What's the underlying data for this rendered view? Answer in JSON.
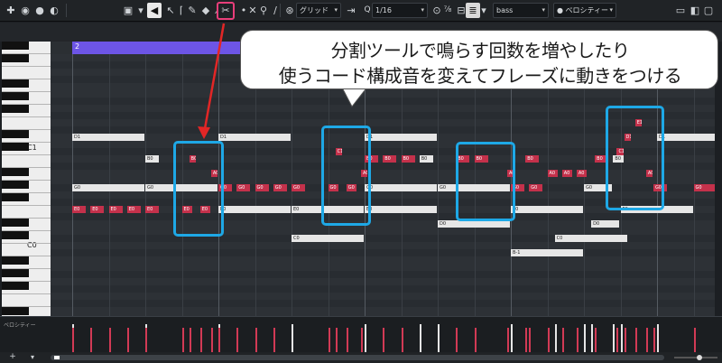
{
  "toolbar": {
    "snap_mode": "グリッド",
    "quantize": "1/16",
    "track": "bass",
    "lane": "ベロシティー"
  },
  "keyboard": {
    "c1_label": "C1",
    "c0_label": "C0"
  },
  "ruler": {
    "bar_number": "2"
  },
  "notes": [
    {
      "pitch": "D1",
      "start": 0,
      "len": 10,
      "row": 11,
      "color": "w"
    },
    {
      "pitch": "D1",
      "start": 20,
      "len": 10,
      "row": 11,
      "color": "w"
    },
    {
      "pitch": "B0",
      "start": 10,
      "len": 2,
      "row": 14,
      "color": "w"
    },
    {
      "pitch": "B0",
      "start": 16,
      "len": 1,
      "row": 14,
      "color": "r"
    },
    {
      "pitch": "A0",
      "start": 19,
      "len": 1,
      "row": 16,
      "color": "r"
    },
    {
      "pitch": "G0",
      "start": 0,
      "len": 10,
      "row": 18,
      "color": "w"
    },
    {
      "pitch": "G0",
      "start": 10,
      "len": 10,
      "row": 18,
      "color": "w"
    },
    {
      "pitch": "E0",
      "start": 0,
      "len": 2,
      "row": 21,
      "color": "r"
    },
    {
      "pitch": "E0",
      "start": 2.5,
      "len": 2,
      "row": 21,
      "color": "r"
    },
    {
      "pitch": "E0",
      "start": 5,
      "len": 2,
      "row": 21,
      "color": "r"
    },
    {
      "pitch": "E0",
      "start": 7.5,
      "len": 2,
      "row": 21,
      "color": "r"
    },
    {
      "pitch": "E0",
      "start": 10,
      "len": 2,
      "row": 21,
      "color": "r"
    },
    {
      "pitch": "E0",
      "start": 15,
      "len": 1.5,
      "row": 21,
      "color": "r"
    },
    {
      "pitch": "E0",
      "start": 17.5,
      "len": 1.5,
      "row": 21,
      "color": "r"
    },
    {
      "pitch": "E0",
      "start": 20,
      "len": 10,
      "row": 21,
      "color": "w"
    },
    {
      "pitch": "G0",
      "start": 20,
      "len": 2,
      "row": 18,
      "color": "r"
    },
    {
      "pitch": "G0",
      "start": 22.5,
      "len": 2,
      "row": 18,
      "color": "r"
    },
    {
      "pitch": "G0",
      "start": 25,
      "len": 2,
      "row": 18,
      "color": "r"
    },
    {
      "pitch": "G0",
      "start": 27.5,
      "len": 2,
      "row": 18,
      "color": "r"
    },
    {
      "pitch": "G0",
      "start": 30,
      "len": 2,
      "row": 18,
      "color": "r"
    },
    {
      "pitch": "G0",
      "start": 35,
      "len": 1.5,
      "row": 18,
      "color": "r"
    },
    {
      "pitch": "E0",
      "start": 30,
      "len": 10,
      "row": 21,
      "color": "w"
    },
    {
      "pitch": "C0",
      "start": 30,
      "len": 10,
      "row": 25,
      "color": "w"
    },
    {
      "pitch": "C1",
      "start": 36,
      "len": 1,
      "row": 13,
      "color": "r"
    },
    {
      "pitch": "A0",
      "start": 39.5,
      "len": 1,
      "row": 16,
      "color": "r"
    },
    {
      "pitch": "G0",
      "start": 37.5,
      "len": 1.5,
      "row": 18,
      "color": "r"
    },
    {
      "pitch": "D1",
      "start": 40,
      "len": 10,
      "row": 11,
      "color": "w"
    },
    {
      "pitch": "B0",
      "start": 40,
      "len": 2,
      "row": 14,
      "color": "r"
    },
    {
      "pitch": "B0",
      "start": 42.5,
      "len": 2,
      "row": 14,
      "color": "r"
    },
    {
      "pitch": "B0",
      "start": 45,
      "len": 2,
      "row": 14,
      "color": "r"
    },
    {
      "pitch": "B0",
      "start": 47.5,
      "len": 2,
      "row": 14,
      "color": "w"
    },
    {
      "pitch": "B0",
      "start": 52.5,
      "len": 2,
      "row": 14,
      "color": "r"
    },
    {
      "pitch": "B0",
      "start": 55,
      "len": 2,
      "row": 14,
      "color": "r"
    },
    {
      "pitch": "G0",
      "start": 40,
      "len": 10,
      "row": 18,
      "color": "w"
    },
    {
      "pitch": "E0",
      "start": 40,
      "len": 10,
      "row": 21,
      "color": "w"
    },
    {
      "pitch": "D0",
      "start": 50,
      "len": 10,
      "row": 23,
      "color": "w"
    },
    {
      "pitch": "G0",
      "start": 50,
      "len": 10,
      "row": 18,
      "color": "w"
    },
    {
      "pitch": "A0",
      "start": 59.5,
      "len": 1,
      "row": 16,
      "color": "r"
    },
    {
      "pitch": "G0",
      "start": 60,
      "len": 2,
      "row": 18,
      "color": "r"
    },
    {
      "pitch": "G0",
      "start": 62.5,
      "len": 2,
      "row": 18,
      "color": "r"
    },
    {
      "pitch": "E0",
      "start": 60,
      "len": 10,
      "row": 21,
      "color": "w"
    },
    {
      "pitch": "B-1",
      "start": 60,
      "len": 10,
      "row": 27,
      "color": "w"
    },
    {
      "pitch": "B0",
      "start": 62,
      "len": 2,
      "row": 14,
      "color": "r"
    },
    {
      "pitch": "A0",
      "start": 65,
      "len": 1.5,
      "row": 16,
      "color": "r"
    },
    {
      "pitch": "A0",
      "start": 67,
      "len": 1.5,
      "row": 16,
      "color": "r"
    },
    {
      "pitch": "A0",
      "start": 69,
      "len": 1.5,
      "row": 16,
      "color": "r"
    },
    {
      "pitch": "C0",
      "start": 66,
      "len": 10,
      "row": 25,
      "color": "w"
    },
    {
      "pitch": "D0",
      "start": 71,
      "len": 4,
      "row": 23,
      "color": "w"
    },
    {
      "pitch": "B0",
      "start": 71.5,
      "len": 2,
      "row": 14,
      "color": "r"
    },
    {
      "pitch": "B0",
      "start": 74,
      "len": 1.5,
      "row": 14,
      "color": "w"
    },
    {
      "pitch": "E1",
      "start": 77,
      "len": 1,
      "row": 9,
      "color": "r"
    },
    {
      "pitch": "D1",
      "start": 75.5,
      "len": 1,
      "row": 11,
      "color": "r"
    },
    {
      "pitch": "C1",
      "start": 74.5,
      "len": 1,
      "row": 13,
      "color": "r"
    },
    {
      "pitch": "A0",
      "start": 78.5,
      "len": 1,
      "row": 16,
      "color": "r"
    },
    {
      "pitch": "G0",
      "start": 70,
      "len": 4,
      "row": 18,
      "color": "w"
    },
    {
      "pitch": "G0",
      "start": 79.5,
      "len": 2,
      "row": 18,
      "color": "r"
    },
    {
      "pitch": "G0",
      "start": 85,
      "len": 4,
      "row": 18,
      "color": "r"
    },
    {
      "pitch": "E0",
      "start": 75,
      "len": 10,
      "row": 21,
      "color": "w"
    },
    {
      "pitch": "D1",
      "start": 80,
      "len": 10,
      "row": 11,
      "color": "w"
    }
  ],
  "annotation": {
    "line1": "分割ツールで鳴らす回数を増やしたり",
    "line2": "使うコード構成音を変えてフレーズに動きをつける"
  },
  "velocity_lane_label": "ベロシティー"
}
